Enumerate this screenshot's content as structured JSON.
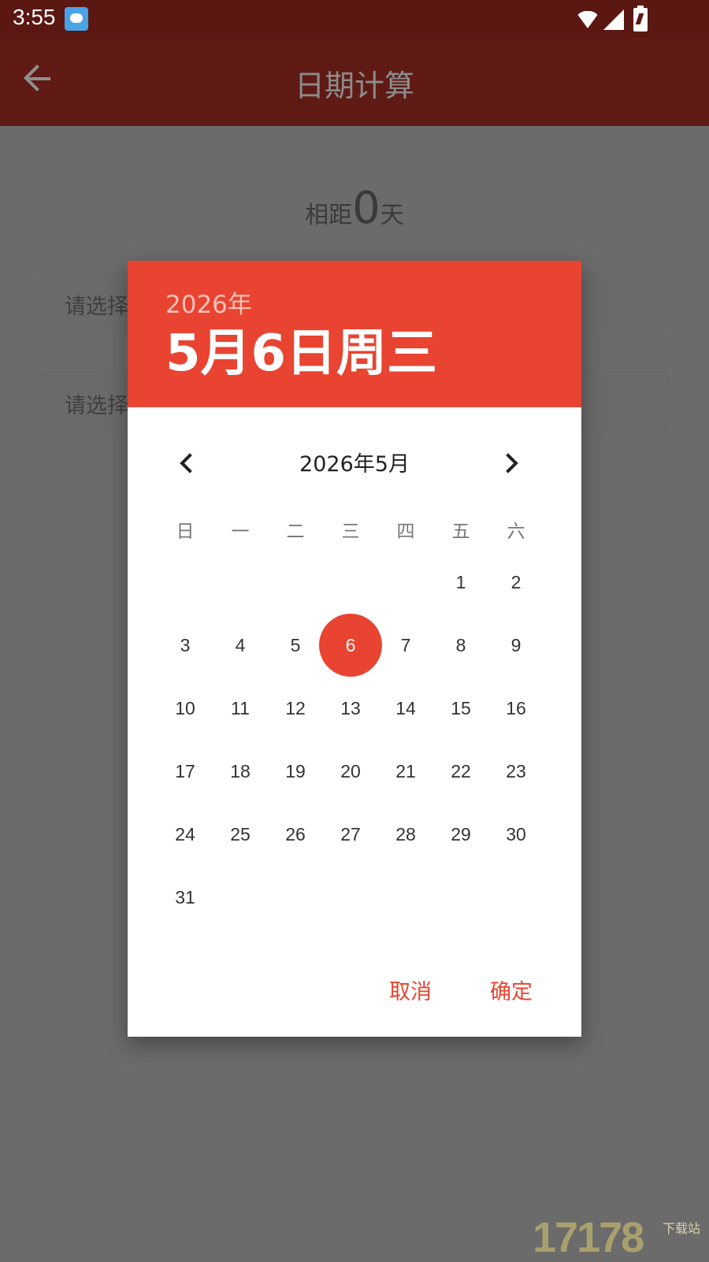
{
  "status": {
    "time": "3:55"
  },
  "header": {
    "title": "日期计算"
  },
  "summary": {
    "prefix": "相距",
    "value": "0",
    "suffix": "天"
  },
  "fields": {
    "start_placeholder": "请选择",
    "end_placeholder": "请选择"
  },
  "dialog": {
    "year": "2026年",
    "date": "5月6日周三",
    "month_title": "2026年5月",
    "weekdays": [
      "日",
      "一",
      "二",
      "三",
      "四",
      "五",
      "六"
    ],
    "days": [
      "1",
      "2",
      "3",
      "4",
      "5",
      "6",
      "7",
      "8",
      "9",
      "10",
      "11",
      "12",
      "13",
      "14",
      "15",
      "16",
      "17",
      "18",
      "19",
      "20",
      "21",
      "22",
      "23",
      "24",
      "25",
      "26",
      "27",
      "28",
      "29",
      "30",
      "31"
    ],
    "selected_day": "6",
    "cancel": "取消",
    "ok": "确定"
  },
  "colors": {
    "status_bar": "#5b1712",
    "app_bar": "#5f1a14",
    "accent": "#e84431",
    "scrim": "#6b6b6b"
  },
  "watermark": {
    "main": "17178",
    "sub": "下载站"
  }
}
